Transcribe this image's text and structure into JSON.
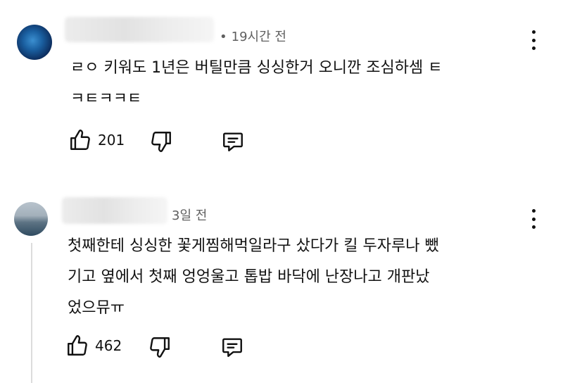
{
  "comments": [
    {
      "time": "19시간 전",
      "lines": [
        "ㄹㅇ 키워도 1년은 버틸만큼 싱싱한거 오니깐 조심하셈 ㅌ",
        "ㅋㅌㅋㅋㅌ"
      ],
      "likes": "201",
      "avatar_icon": "avatar-blue-orb"
    },
    {
      "time": "3일 전",
      "lines": [
        "첫째한테 싱싱한 꽃게찜해먹일라구 샀다가 킬 두자루나 뺐",
        "기고 옆에서 첫째 엉엉울고 톱밥 바닥에 난장나고 개판났",
        "었으뮤ㅠ"
      ],
      "likes": "462",
      "avatar_icon": "avatar-landscape"
    }
  ],
  "icons": {
    "like": "thumbs-up-icon",
    "dislike": "thumbs-down-icon",
    "reply": "reply-icon",
    "menu": "more-vertical-icon"
  }
}
